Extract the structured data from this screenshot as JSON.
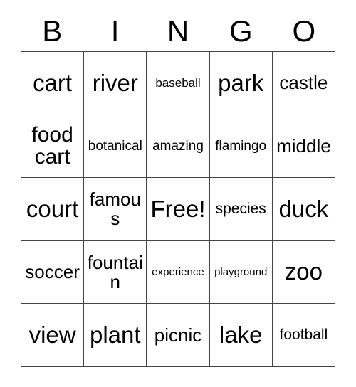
{
  "card": {
    "title": "BINGO",
    "header": [
      {
        "letter": "B"
      },
      {
        "letter": "I"
      },
      {
        "letter": "N"
      },
      {
        "letter": "G"
      },
      {
        "letter": "O"
      }
    ],
    "free_space_label": "Free!",
    "colors": {
      "background": "#ffffff",
      "text": "#000000",
      "grid_line": "#444444"
    },
    "rows": [
      [
        {
          "text": "cart",
          "size": "sz-xl"
        },
        {
          "text": "river",
          "size": "sz-xl"
        },
        {
          "text": "baseball",
          "size": "sz-xxs"
        },
        {
          "text": "park",
          "size": "sz-xl"
        },
        {
          "text": "castle",
          "size": "sz-md"
        }
      ],
      [
        {
          "text": "food cart",
          "size": "sz-lg"
        },
        {
          "text": "botanical",
          "size": "sz-xs"
        },
        {
          "text": "amazing",
          "size": "sz-xs"
        },
        {
          "text": "flamingo",
          "size": "sz-xs"
        },
        {
          "text": "middle",
          "size": "sz-md"
        }
      ],
      [
        {
          "text": "court",
          "size": "sz-xl"
        },
        {
          "text": "famous",
          "size": "sz-md"
        },
        {
          "text": "Free!",
          "size": "sz-xl"
        },
        {
          "text": "species",
          "size": "sz-sm"
        },
        {
          "text": "duck",
          "size": "sz-xl"
        }
      ],
      [
        {
          "text": "soccer",
          "size": "sz-md"
        },
        {
          "text": "fountain",
          "size": "sz-md"
        },
        {
          "text": "experience",
          "size": "sz-tiny"
        },
        {
          "text": "playground",
          "size": "sz-tiny"
        },
        {
          "text": "zoo",
          "size": "sz-xl"
        }
      ],
      [
        {
          "text": "view",
          "size": "sz-xl"
        },
        {
          "text": "plant",
          "size": "sz-xl"
        },
        {
          "text": "picnic",
          "size": "sz-md"
        },
        {
          "text": "lake",
          "size": "sz-xl"
        },
        {
          "text": "football",
          "size": "sz-sm"
        }
      ]
    ]
  }
}
